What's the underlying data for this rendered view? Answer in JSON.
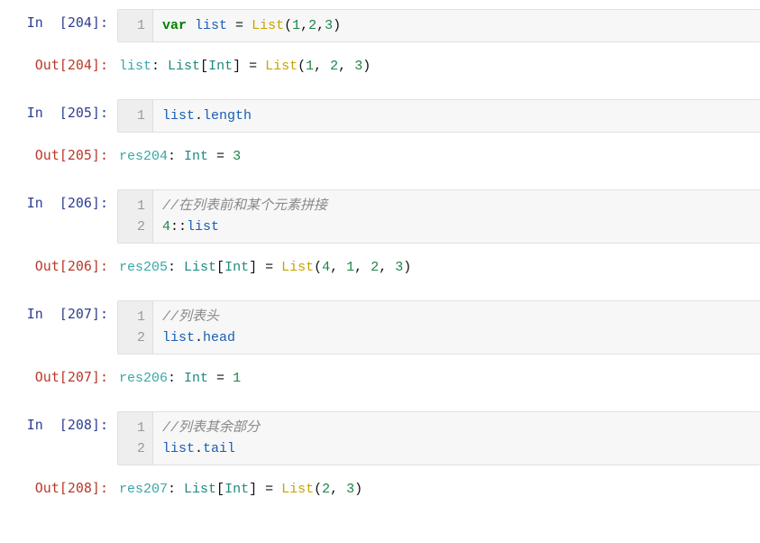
{
  "cells": [
    {
      "in_prompt": "In  [204]:",
      "out_prompt": "Out[204]:",
      "code_lines": [
        {
          "gutter": "1",
          "tokens": [
            {
              "cls": "kw",
              "t": "var"
            },
            {
              "cls": "pun",
              "t": " "
            },
            {
              "cls": "id",
              "t": "list"
            },
            {
              "cls": "pun",
              "t": " = "
            },
            {
              "cls": "fn",
              "t": "List"
            },
            {
              "cls": "pun",
              "t": "("
            },
            {
              "cls": "num",
              "t": "1"
            },
            {
              "cls": "pun",
              "t": ","
            },
            {
              "cls": "num",
              "t": "2"
            },
            {
              "cls": "pun",
              "t": ","
            },
            {
              "cls": "num",
              "t": "3"
            },
            {
              "cls": "pun",
              "t": ")"
            }
          ]
        }
      ],
      "out_tokens": [
        {
          "cls": "o-id",
          "t": "list"
        },
        {
          "cls": "pun",
          "t": ": "
        },
        {
          "cls": "o-type",
          "t": "List"
        },
        {
          "cls": "pun",
          "t": "["
        },
        {
          "cls": "o-type",
          "t": "Int"
        },
        {
          "cls": "pun",
          "t": "] = "
        },
        {
          "cls": "o-fn",
          "t": "List"
        },
        {
          "cls": "pun",
          "t": "("
        },
        {
          "cls": "o-num",
          "t": "1"
        },
        {
          "cls": "pun",
          "t": ", "
        },
        {
          "cls": "o-num",
          "t": "2"
        },
        {
          "cls": "pun",
          "t": ", "
        },
        {
          "cls": "o-num",
          "t": "3"
        },
        {
          "cls": "pun",
          "t": ")"
        }
      ]
    },
    {
      "in_prompt": "In  [205]:",
      "out_prompt": "Out[205]:",
      "code_lines": [
        {
          "gutter": "1",
          "tokens": [
            {
              "cls": "id",
              "t": "list"
            },
            {
              "cls": "pun",
              "t": "."
            },
            {
              "cls": "id",
              "t": "length"
            }
          ]
        }
      ],
      "out_tokens": [
        {
          "cls": "o-id",
          "t": "res204"
        },
        {
          "cls": "pun",
          "t": ": "
        },
        {
          "cls": "o-type",
          "t": "Int"
        },
        {
          "cls": "pun",
          "t": " = "
        },
        {
          "cls": "o-num",
          "t": "3"
        }
      ]
    },
    {
      "in_prompt": "In  [206]:",
      "out_prompt": "Out[206]:",
      "code_lines": [
        {
          "gutter": "1",
          "tokens": [
            {
              "cls": "cmt",
              "t": "//在列表前和某个元素拼接"
            }
          ]
        },
        {
          "gutter": "2",
          "tokens": [
            {
              "cls": "num",
              "t": "4"
            },
            {
              "cls": "pun",
              "t": "::"
            },
            {
              "cls": "id",
              "t": "list"
            }
          ]
        }
      ],
      "out_tokens": [
        {
          "cls": "o-id",
          "t": "res205"
        },
        {
          "cls": "pun",
          "t": ": "
        },
        {
          "cls": "o-type",
          "t": "List"
        },
        {
          "cls": "pun",
          "t": "["
        },
        {
          "cls": "o-type",
          "t": "Int"
        },
        {
          "cls": "pun",
          "t": "] = "
        },
        {
          "cls": "o-fn",
          "t": "List"
        },
        {
          "cls": "pun",
          "t": "("
        },
        {
          "cls": "o-num",
          "t": "4"
        },
        {
          "cls": "pun",
          "t": ", "
        },
        {
          "cls": "o-num",
          "t": "1"
        },
        {
          "cls": "pun",
          "t": ", "
        },
        {
          "cls": "o-num",
          "t": "2"
        },
        {
          "cls": "pun",
          "t": ", "
        },
        {
          "cls": "o-num",
          "t": "3"
        },
        {
          "cls": "pun",
          "t": ")"
        }
      ]
    },
    {
      "in_prompt": "In  [207]:",
      "out_prompt": "Out[207]:",
      "code_lines": [
        {
          "gutter": "1",
          "tokens": [
            {
              "cls": "cmt",
              "t": "//列表头"
            }
          ]
        },
        {
          "gutter": "2",
          "tokens": [
            {
              "cls": "id",
              "t": "list"
            },
            {
              "cls": "pun",
              "t": "."
            },
            {
              "cls": "id",
              "t": "head"
            }
          ]
        }
      ],
      "out_tokens": [
        {
          "cls": "o-id",
          "t": "res206"
        },
        {
          "cls": "pun",
          "t": ": "
        },
        {
          "cls": "o-type",
          "t": "Int"
        },
        {
          "cls": "pun",
          "t": " = "
        },
        {
          "cls": "o-num",
          "t": "1"
        }
      ]
    },
    {
      "in_prompt": "In  [208]:",
      "out_prompt": "Out[208]:",
      "code_lines": [
        {
          "gutter": "1",
          "tokens": [
            {
              "cls": "cmt",
              "t": "//列表其余部分"
            }
          ]
        },
        {
          "gutter": "2",
          "tokens": [
            {
              "cls": "id",
              "t": "list"
            },
            {
              "cls": "pun",
              "t": "."
            },
            {
              "cls": "id",
              "t": "tail"
            }
          ]
        }
      ],
      "out_tokens": [
        {
          "cls": "o-id",
          "t": "res207"
        },
        {
          "cls": "pun",
          "t": ": "
        },
        {
          "cls": "o-type",
          "t": "List"
        },
        {
          "cls": "pun",
          "t": "["
        },
        {
          "cls": "o-type",
          "t": "Int"
        },
        {
          "cls": "pun",
          "t": "] = "
        },
        {
          "cls": "o-fn",
          "t": "List"
        },
        {
          "cls": "pun",
          "t": "("
        },
        {
          "cls": "o-num",
          "t": "2"
        },
        {
          "cls": "pun",
          "t": ", "
        },
        {
          "cls": "o-num",
          "t": "3"
        },
        {
          "cls": "pun",
          "t": ")"
        }
      ]
    }
  ]
}
